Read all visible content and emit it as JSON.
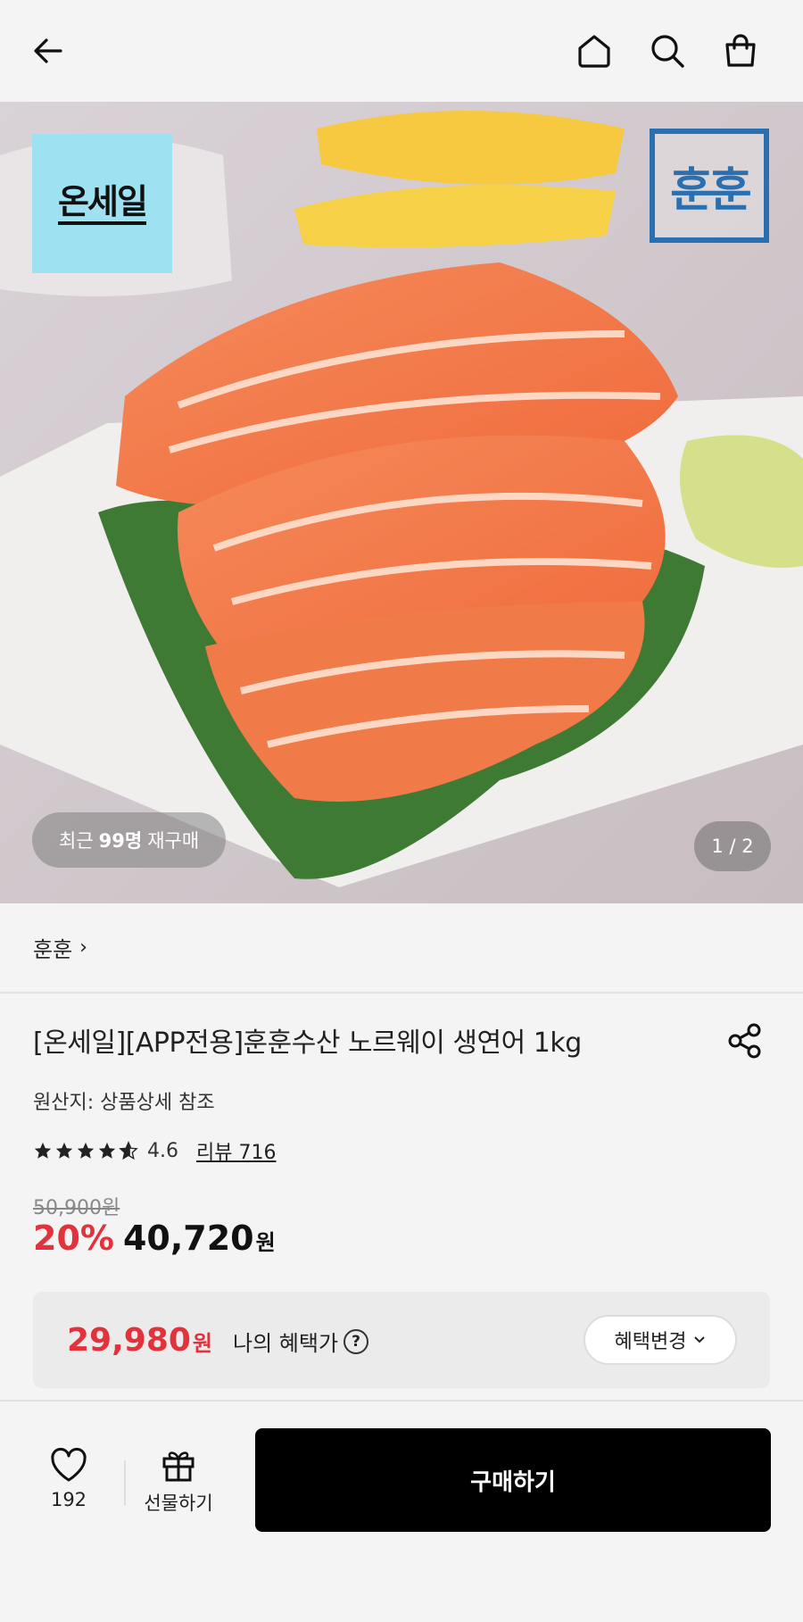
{
  "header": {
    "back_icon": "arrow-left-icon",
    "home_icon": "home-icon",
    "search_icon": "search-icon",
    "bag_icon": "shopping-bag-icon"
  },
  "hero": {
    "onsale_badge": "온세일",
    "brand_logo": "훈훈",
    "repurchase_prefix": "최근",
    "repurchase_count": "99명",
    "repurchase_suffix": "재구매",
    "pager": "1 / 2"
  },
  "brand": {
    "name": "훈훈",
    "chevron": "›"
  },
  "product": {
    "title": "[온세일][APP전용]훈훈수산 노르웨이 생연어 1kg",
    "origin": "원산지: 상품상세 참조",
    "rating": "4.6",
    "rating_stars": 4.6,
    "review_label": "리뷰 716",
    "original_price": "50,900원",
    "discount": "20%",
    "price": "40,720",
    "price_unit": "원"
  },
  "benefit": {
    "price": "29,980",
    "price_unit": "원",
    "label": "나의 혜택가",
    "help": "?",
    "change_label": "혜택변경"
  },
  "bottom": {
    "like_count": "192",
    "gift_label": "선물하기",
    "buy_label": "구매하기"
  },
  "colors": {
    "accent_red": "#e2323b",
    "onsale_bg": "#9ee2f2",
    "logo_blue": "#2a6fb0",
    "buy_bg": "#000000"
  }
}
